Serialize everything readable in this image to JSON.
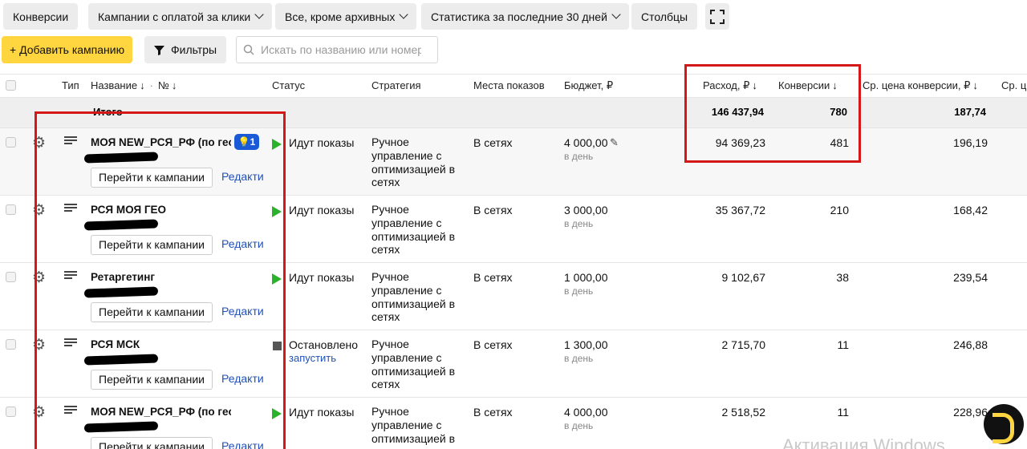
{
  "toolbar": {
    "conversions": "Конверсии",
    "campaign_type": "Кампании с оплатой за клики",
    "archive_filter": "Все, кроме архивных",
    "period": "Статистика за последние 30 дней",
    "columns": "Столбцы",
    "add_campaign": "+ Добавить кампанию",
    "filters": "Фильтры",
    "search_placeholder": "Искать по названию или номеру"
  },
  "headers": {
    "type": "Тип",
    "name": "Название",
    "number": "№",
    "status": "Статус",
    "strategy": "Стратегия",
    "placements": "Места показов",
    "budget": "Бюджет, ₽",
    "spend": "Расход, ₽",
    "conversions": "Конверсии",
    "cpa": "Ср. цена конверсии, ₽",
    "cpc_cut": "Ср. ц"
  },
  "totals": {
    "label": "Итого",
    "spend": "146 437,94",
    "conversions": "780",
    "cpa": "187,74"
  },
  "row_actions": {
    "goto": "Перейти к кампании",
    "edit": "Редактировать"
  },
  "rows": [
    {
      "name": "МОЯ NEW_РСЯ_РФ (по гео) - пк",
      "status": "Идут показы",
      "status_action": "",
      "strategy": "Ручное управление с оптимизацией в сетях",
      "placement": "В сетях",
      "budget": "4 000,00",
      "budget_period": "в день",
      "spend": "94 369,23",
      "conversions": "481",
      "cpa": "196,19",
      "badge": "1"
    },
    {
      "name": "РСЯ МОЯ ГЕО",
      "status": "Идут показы",
      "status_action": "",
      "strategy": "Ручное управление с оптимизацией в сетях",
      "placement": "В сетях",
      "budget": "3 000,00",
      "budget_period": "в день",
      "spend": "35 367,72",
      "conversions": "210",
      "cpa": "168,42"
    },
    {
      "name": "Ретаргетинг",
      "status": "Идут показы",
      "status_action": "",
      "strategy": "Ручное управление с оптимизацией в сетях",
      "placement": "В сетях",
      "budget": "1 000,00",
      "budget_period": "в день",
      "spend": "9 102,67",
      "conversions": "38",
      "cpa": "239,54"
    },
    {
      "name": "РСЯ МСК",
      "status": "Остановлено",
      "status_action": "запустить",
      "strategy": "Ручное управление с оптимизацией в сетях",
      "placement": "В сетях",
      "budget": "1 300,00",
      "budget_period": "в день",
      "spend": "2 715,70",
      "conversions": "11",
      "cpa": "246,88"
    },
    {
      "name": "МОЯ NEW_РСЯ_РФ (по гео) - пк",
      "status": "Идут показы",
      "status_action": "",
      "strategy": "Ручное управление с оптимизацией в сетях",
      "placement": "В сетях",
      "budget": "4 000,00",
      "budget_period": "в день",
      "spend": "2 518,52",
      "conversions": "11",
      "cpa": "228,96"
    }
  ],
  "watermark": "Активация Windows",
  "colors": {
    "accent_yellow": "#ffd540",
    "highlight_red": "#d41818",
    "link_blue": "#2050b8",
    "play_green": "#2bb12b"
  }
}
